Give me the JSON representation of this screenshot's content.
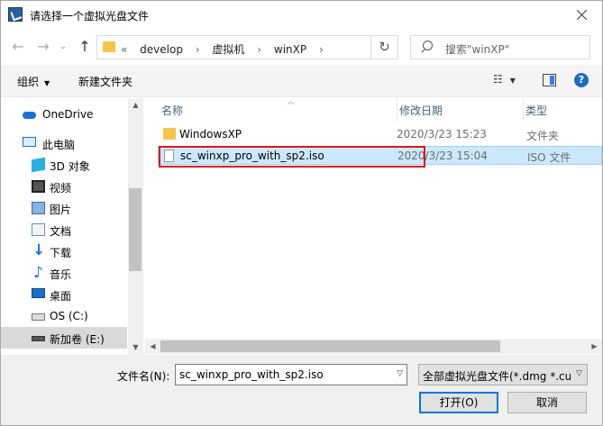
{
  "window": {
    "title": "请选择一个虚拟光盘文件"
  },
  "nav": {
    "back": "←",
    "forward": "→",
    "recent": "⌄",
    "up": "↑",
    "breadcrumb": [
      "«",
      "develop",
      "›",
      "虚拟机",
      "›",
      "winXP",
      "›"
    ],
    "refresh": "↻",
    "search_placeholder": "搜索\"winXP\""
  },
  "toolbar": {
    "organize": "组织",
    "new_folder": "新建文件夹",
    "view": "☷"
  },
  "sidebar": {
    "items": [
      {
        "label": "OneDrive",
        "icon": "cloud-icon"
      },
      {
        "label": "此电脑",
        "icon": "computer-icon"
      },
      {
        "label": "3D 对象",
        "icon": "cube-icon"
      },
      {
        "label": "视频",
        "icon": "video-icon"
      },
      {
        "label": "图片",
        "icon": "picture-icon"
      },
      {
        "label": "文档",
        "icon": "document-icon"
      },
      {
        "label": "下载",
        "icon": "download-icon"
      },
      {
        "label": "音乐",
        "icon": "music-icon"
      },
      {
        "label": "桌面",
        "icon": "desktop-icon"
      },
      {
        "label": "OS (C:)",
        "icon": "drive-icon"
      },
      {
        "label": "新加卷 (E:)",
        "icon": "drive-icon",
        "selected": true
      }
    ]
  },
  "filelist": {
    "columns": {
      "name": "名称",
      "date": "修改日期",
      "type": "类型"
    },
    "rows": [
      {
        "name": "WindowsXP",
        "date": "2020/3/23 15:23",
        "type": "文件夹",
        "icon": "folder-icon"
      },
      {
        "name": "sc_winxp_pro_with_sp2.iso",
        "date": "2020/3/23 15:04",
        "type": "ISO 文件",
        "icon": "file-icon",
        "selected": true
      }
    ]
  },
  "footer": {
    "filename_label": "文件名(N):",
    "filename_value": "sc_winxp_pro_with_sp2.iso",
    "filter_value": "全部虚拟光盘文件(*.dmg *.cue",
    "open_button": "打开(O)",
    "cancel_button": "取消"
  },
  "colors": {
    "accent": "#0078d7",
    "selection": "#cce8ff",
    "highlight": "#e0141e"
  }
}
